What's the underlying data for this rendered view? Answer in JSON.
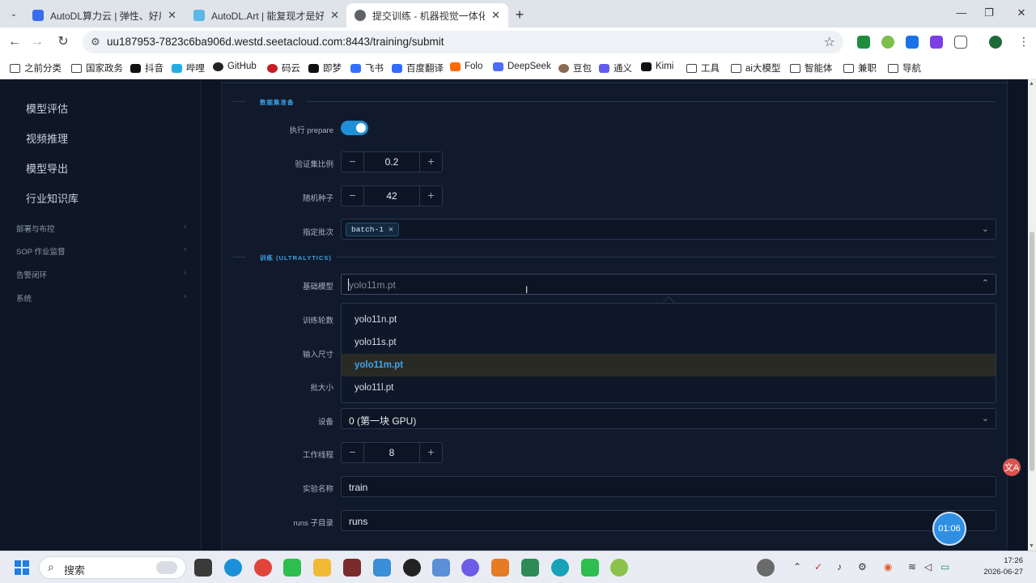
{
  "browser": {
    "tabs": [
      {
        "title": "AutoDL算力云 | 弹性、好用、",
        "color": "#3b6cf0"
      },
      {
        "title": "AutoDL.Art | 能复现才是好算",
        "color": "#5ab8e6"
      },
      {
        "title": "提交训练 - 机器视觉一体化服务",
        "color": "#5f6368"
      }
    ],
    "url": "uu187953-7823c6ba906d.westd.seetacloud.com:8443/training/submit",
    "bookmarks": [
      "之前分类",
      "国家政务",
      "抖音",
      "哔哩",
      "GitHub",
      "码云",
      "即梦",
      "飞书",
      "百度翻译",
      "Folo",
      "DeepSeek",
      "豆包",
      "通义",
      "Kimi",
      "工具",
      "ai大模型",
      "智能体",
      "兼职",
      "导航"
    ]
  },
  "sidebar": {
    "items": [
      "模型评估",
      "视频推理",
      "模型导出",
      "行业知识库"
    ],
    "groups": [
      "部署与布控",
      "SOP 作业监督",
      "告警闭环",
      "系统"
    ]
  },
  "form": {
    "section_data": "数据集准备",
    "prepare_label": "执行 prepare",
    "val_ratio_label": "验证集比例",
    "val_ratio_value": "0.2",
    "seed_label": "随机种子",
    "seed_value": "42",
    "batch_label": "指定批次",
    "batch_tag": "batch-1",
    "section_train": "训练 (ULTRALYTICS)",
    "base_model_label": "基础模型",
    "base_model_placeholder": "yolo11m.pt",
    "epochs_label": "训练轮数",
    "imgsz_label": "输入尺寸",
    "batch_size_label": "批大小",
    "device_label": "设备",
    "device_value": "0 (第一块 GPU)",
    "workers_label": "工作线程",
    "workers_value": "8",
    "exp_label": "实验名称",
    "exp_value": "train",
    "runs_label": "runs 子目录",
    "runs_value": "runs",
    "minus": "−",
    "plus": "+",
    "model_options": [
      "yolo11n.pt",
      "yolo11s.pt",
      "yolo11m.pt",
      "yolo11l.pt"
    ],
    "selected_option": "yolo11m.pt"
  },
  "overlay": {
    "timer": "01:06",
    "translate": "文A"
  },
  "taskbar": {
    "search": "搜索",
    "time": "17:26",
    "date": "2026-06-27"
  },
  "colors": {
    "accent": "#3da0e6",
    "toggle": "#1f8fd6",
    "page_bg": "#0d1524"
  }
}
